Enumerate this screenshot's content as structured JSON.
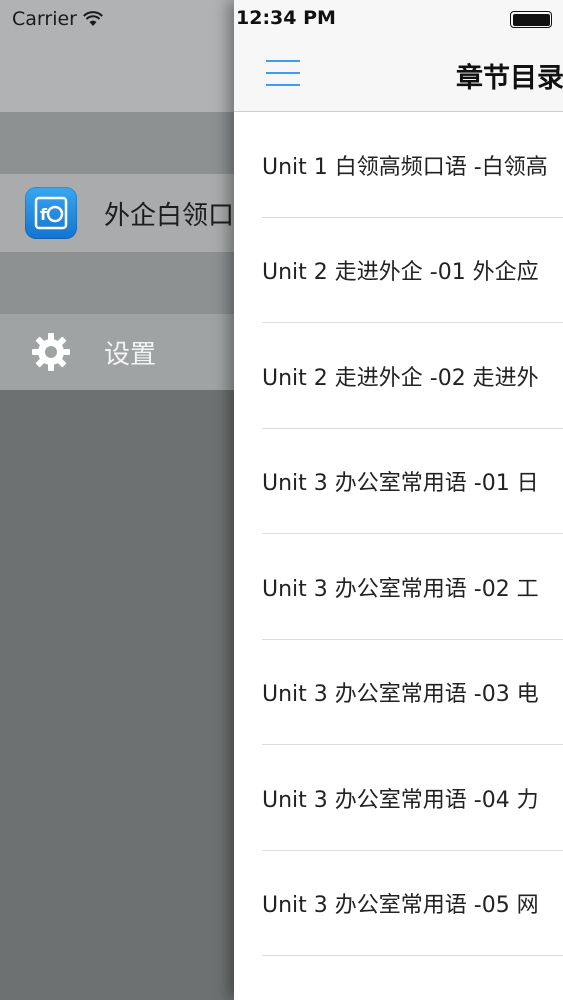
{
  "status_bar": {
    "carrier": "Carrier",
    "time": "12:34 PM"
  },
  "menu": {
    "app_item_label": "外企白领口",
    "settings_label": "设置"
  },
  "nav": {
    "title": "章节目录"
  },
  "chapters": [
    "Unit 1 白领高频口语 -白领高",
    "Unit 2 走进外企 -01 外企应",
    "Unit 2 走进外企 -02 走进外",
    "Unit 3 办公室常用语 -01 日",
    "Unit 3 办公室常用语 -02 工",
    "Unit 3 办公室常用语 -03 电",
    "Unit 3 办公室常用语 -04 力",
    "Unit 3 办公室常用语 -05 网"
  ],
  "colors": {
    "accent": "#3d9df4",
    "app_icon": "#1f86e0"
  }
}
